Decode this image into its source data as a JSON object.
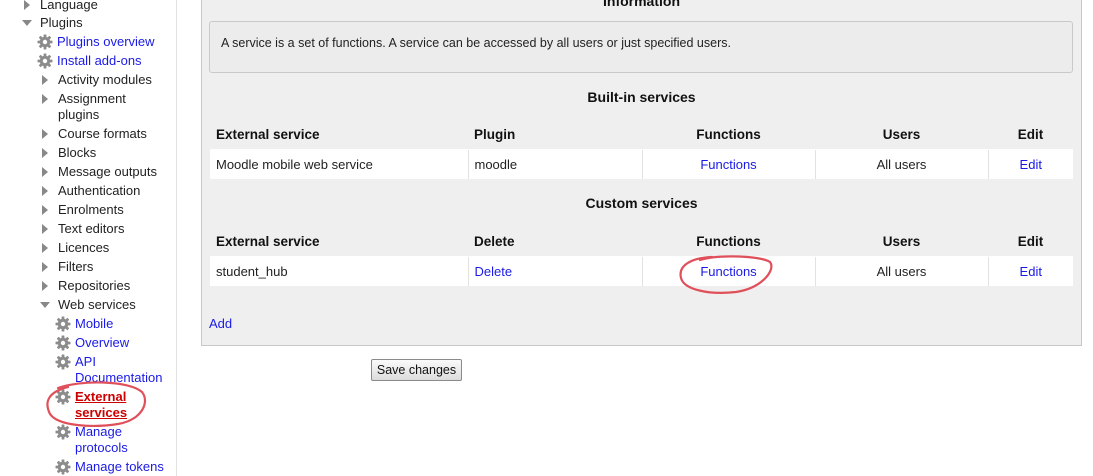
{
  "sidebar": {
    "language": "Language",
    "plugins": "Plugins",
    "plugins_overview": "Plugins overview",
    "install_addons": "Install add-ons",
    "activity_modules": "Activity modules",
    "assignment_plugins_1": "Assignment",
    "assignment_plugins_2": "plugins",
    "course_formats": "Course formats",
    "blocks": "Blocks",
    "message_outputs": "Message outputs",
    "authentication": "Authentication",
    "enrolments": "Enrolments",
    "text_editors": "Text editors",
    "licences": "Licences",
    "filters": "Filters",
    "repositories": "Repositories",
    "web_services": "Web services",
    "mobile": "Mobile",
    "overview": "Overview",
    "api_doc_1": "API",
    "api_doc_2": "Documentation",
    "external_services_1": "External",
    "external_services_2": "services",
    "manage_protocols_1": "Manage",
    "manage_protocols_2": "protocols",
    "manage_tokens": "Manage tokens"
  },
  "main": {
    "info_title": "Information",
    "info_text": "A service is a set of functions. A service can be accessed by all users or just specified users.",
    "builtin_title": "Built-in services",
    "builtin_headers": [
      "External service",
      "Plugin",
      "Functions",
      "Users",
      "Edit"
    ],
    "builtin_rows": [
      [
        "Moodle mobile web service",
        "moodle",
        "Functions",
        "All users",
        "Edit"
      ]
    ],
    "custom_title": "Custom services",
    "custom_headers": [
      "External service",
      "Delete",
      "Functions",
      "Users",
      "Edit"
    ],
    "custom_rows": [
      [
        "student_hub",
        "Delete",
        "Functions",
        "All users",
        "Edit"
      ]
    ],
    "add_label": "Add",
    "save_label": "Save changes"
  },
  "colors": {
    "link": "#1a1ae6",
    "annotation": "#e0505a",
    "panel_bg": "#efefef"
  }
}
